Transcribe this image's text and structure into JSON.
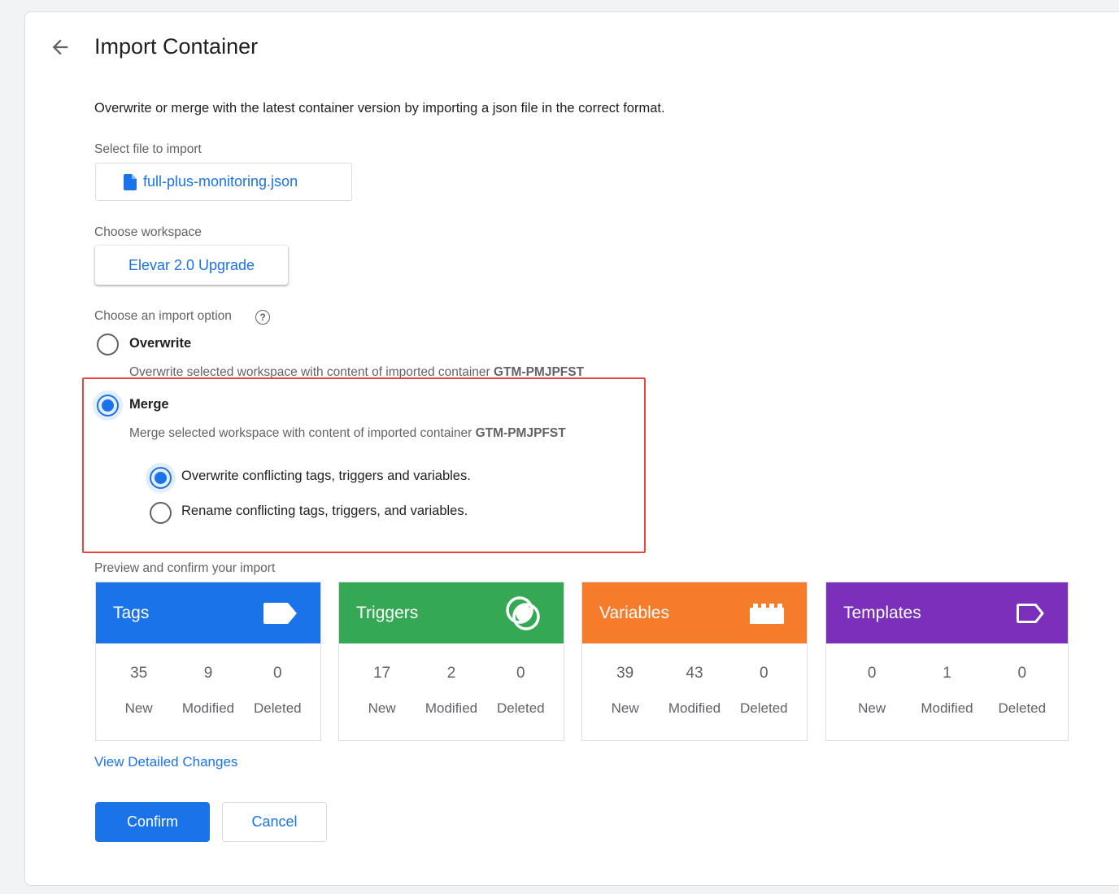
{
  "header": {
    "title": "Import Container"
  },
  "description": "Overwrite or merge with the latest container version by importing a json file in the correct format.",
  "file": {
    "label": "Select file to import",
    "filename": "full-plus-monitoring.json"
  },
  "workspace": {
    "label": "Choose workspace",
    "value": "Elevar 2.0 Upgrade"
  },
  "import_option": {
    "label": "Choose an import option",
    "help_glyph": "?",
    "overwrite": {
      "name": "Overwrite",
      "desc": "Overwrite selected workspace with content of imported container ",
      "container": "GTM-PMJPFST",
      "selected": false
    },
    "merge": {
      "name": "Merge",
      "desc": "Merge selected workspace with content of imported container ",
      "container": "GTM-PMJPFST",
      "selected": true,
      "sub_options": [
        {
          "label": "Overwrite conflicting tags, triggers and variables.",
          "selected": true
        },
        {
          "label": "Rename conflicting tags, triggers, and variables.",
          "selected": false
        }
      ]
    }
  },
  "preview": {
    "label": "Preview and confirm your import",
    "cards": [
      {
        "title": "Tags",
        "color": "#1a73e8",
        "icon": "tag-icon",
        "new": "35",
        "modified": "9",
        "deleted": "0",
        "new_label": "New",
        "modified_label": "Modified",
        "deleted_label": "Deleted"
      },
      {
        "title": "Triggers",
        "color": "#34a853",
        "icon": "trigger-icon",
        "new": "17",
        "modified": "2",
        "deleted": "0",
        "new_label": "New",
        "modified_label": "Modified",
        "deleted_label": "Deleted"
      },
      {
        "title": "Variables",
        "color": "#f57c2a",
        "icon": "variable-icon",
        "new": "39",
        "modified": "43",
        "deleted": "0",
        "new_label": "New",
        "modified_label": "Modified",
        "deleted_label": "Deleted"
      },
      {
        "title": "Templates",
        "color": "#7b2fba",
        "icon": "template-icon",
        "new": "0",
        "modified": "1",
        "deleted": "0",
        "new_label": "New",
        "modified_label": "Modified",
        "deleted_label": "Deleted"
      }
    ]
  },
  "view_changes_link": "View Detailed Changes",
  "buttons": {
    "confirm": "Confirm",
    "cancel": "Cancel"
  }
}
